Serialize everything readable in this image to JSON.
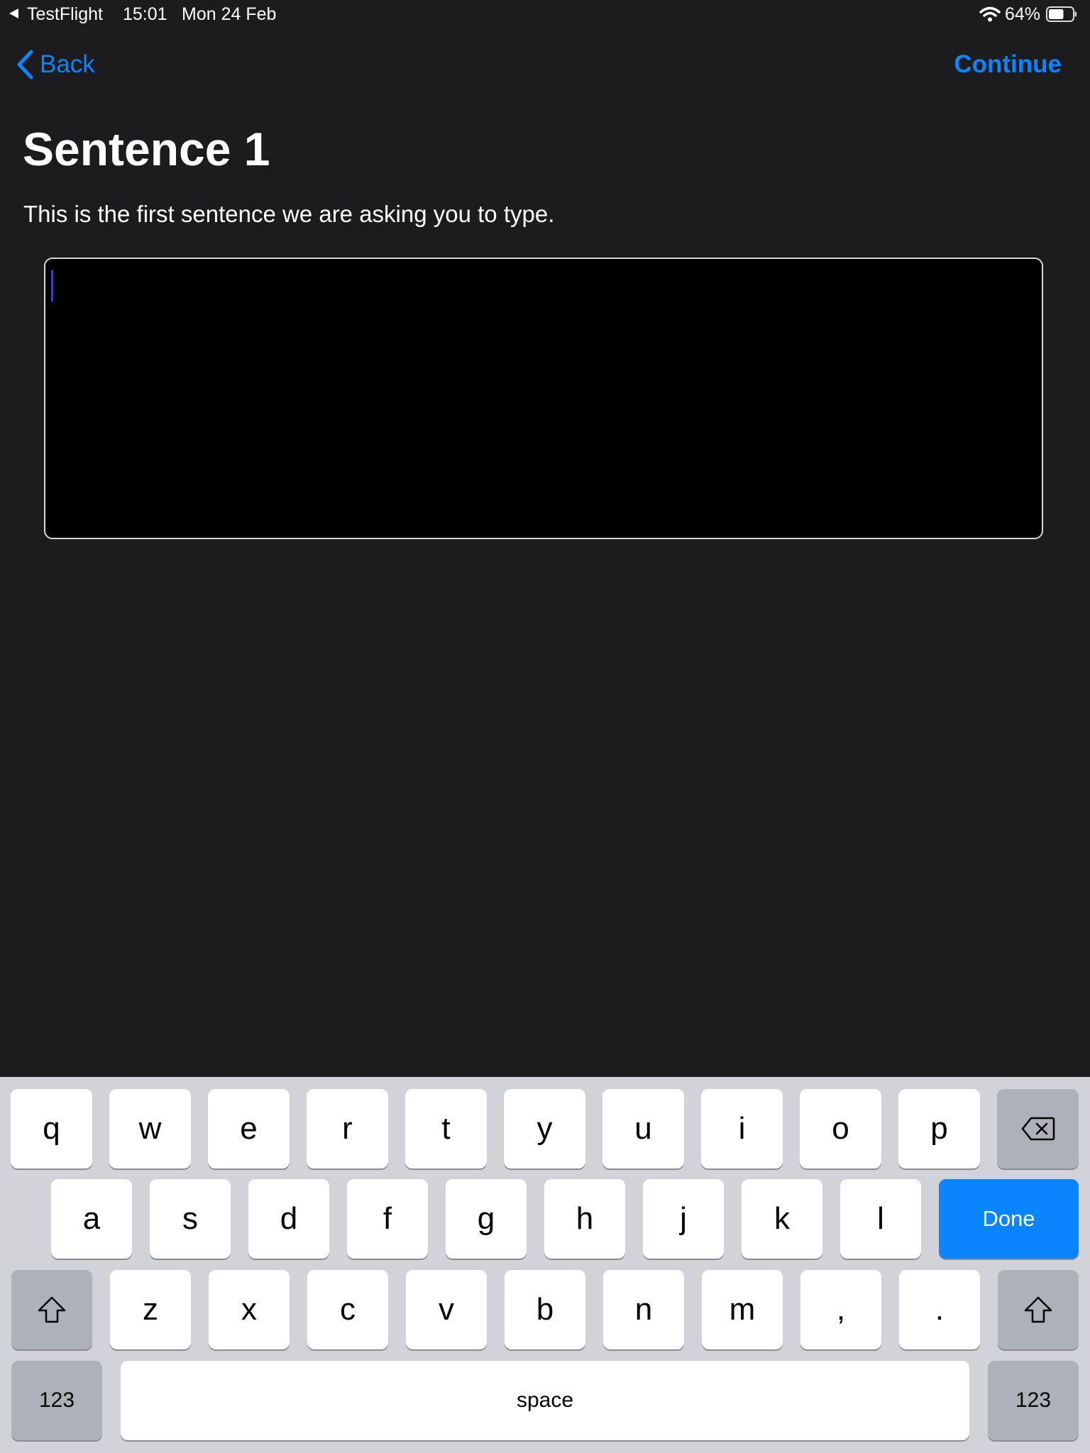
{
  "status_bar": {
    "back_app": "TestFlight",
    "time": "15:01",
    "date": "Mon 24 Feb",
    "battery_percent": "64%",
    "battery_level": 0.64
  },
  "nav": {
    "back_label": "Back",
    "continue_label": "Continue"
  },
  "content": {
    "title": "Sentence 1",
    "instruction": "This is the first sentence we are asking you to type.",
    "input_value": ""
  },
  "keyboard": {
    "row1": [
      "q",
      "w",
      "e",
      "r",
      "t",
      "y",
      "u",
      "i",
      "o",
      "p"
    ],
    "row2": [
      "a",
      "s",
      "d",
      "f",
      "g",
      "h",
      "j",
      "k",
      "l"
    ],
    "row3": [
      "z",
      "x",
      "c",
      "v",
      "b",
      "n",
      "m",
      ",",
      "."
    ],
    "done_label": "Done",
    "space_label": "space",
    "numbers_label": "123"
  },
  "colors": {
    "accent": "#0a84ff",
    "background": "#1c1c1e",
    "keyboard_bg": "#d1d3d9"
  }
}
